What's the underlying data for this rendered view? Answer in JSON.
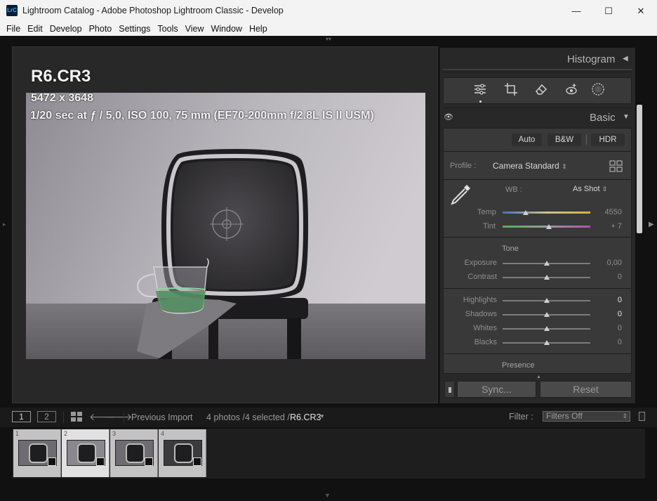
{
  "window": {
    "logo_text": "LrC",
    "title": "Lightroom Catalog - Adobe Photoshop Lightroom Classic - Develop",
    "minimize": "—",
    "maximize": "☐",
    "close": "✕"
  },
  "menu": [
    "File",
    "Edit",
    "Develop",
    "Photo",
    "Settings",
    "Tools",
    "View",
    "Window",
    "Help"
  ],
  "info_overlay": {
    "filename": "R6.CR3",
    "dimensions": "5472 x 3648",
    "exposure": "1/20 sec at ƒ / 5,0, ISO 100, 75 mm (EF70-200mm f/2.8L IS II USM)"
  },
  "right_panel": {
    "histogram_label": "Histogram",
    "basic_label": "Basic",
    "treatment_buttons": [
      "Auto",
      "B&W",
      "HDR"
    ],
    "profile_label": "Profile :",
    "profile_value": "Camera Standard",
    "wb_label": "WB :",
    "wb_value": "As Shot",
    "temp": {
      "label": "Temp",
      "value": "4550",
      "position": 0.26
    },
    "tint": {
      "label": "Tint",
      "value": "+ 7",
      "position": 0.53
    },
    "tone_label": "Tone",
    "tone_sliders": [
      {
        "label": "Exposure",
        "value": "0,00",
        "position": 0.5,
        "bright": false
      },
      {
        "label": "Contrast",
        "value": "0",
        "position": 0.5,
        "bright": false
      }
    ],
    "presence_sliders": [
      {
        "label": "Highlights",
        "value": "0",
        "position": 0.5,
        "bright": true
      },
      {
        "label": "Shadows",
        "value": "0",
        "position": 0.5,
        "bright": true
      },
      {
        "label": "Whites",
        "value": "0",
        "position": 0.5,
        "bright": false
      },
      {
        "label": "Blacks",
        "value": "0",
        "position": 0.5,
        "bright": false
      }
    ],
    "presence_label": "Presence",
    "sync_label": "Sync...",
    "reset_label": "Reset"
  },
  "filmstrip_toolbar": {
    "monitor1": "1",
    "monitor2": "2",
    "source": "Previous Import",
    "count": "4 photos /4 selected /",
    "current_file": "R6.CR3",
    "filter_label": "Filter :",
    "filter_value": "Filters Off"
  },
  "filmstrip": [
    {
      "num": "1",
      "selected": false
    },
    {
      "num": "2",
      "selected": true
    },
    {
      "num": "3",
      "selected": false
    },
    {
      "num": "4",
      "selected": false
    }
  ]
}
